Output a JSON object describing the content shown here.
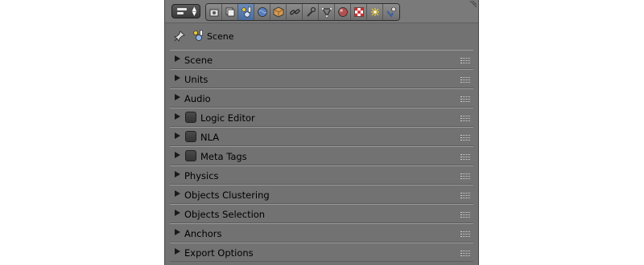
{
  "header": {
    "editor_type_icon": "properties-editor-icon",
    "tabs": [
      {
        "icon": "render-icon",
        "active": false
      },
      {
        "icon": "render-layers-icon",
        "active": false
      },
      {
        "icon": "scene-icon",
        "active": true
      },
      {
        "icon": "world-icon",
        "active": false
      },
      {
        "icon": "object-icon",
        "active": false
      },
      {
        "icon": "constraints-icon",
        "active": false
      },
      {
        "icon": "modifier-wrench-icon",
        "active": false
      },
      {
        "icon": "mesh-data-icon",
        "active": false
      },
      {
        "icon": "material-icon",
        "active": false
      },
      {
        "icon": "texture-icon",
        "active": false
      },
      {
        "icon": "particles-icon",
        "active": false
      },
      {
        "icon": "physics-icon",
        "active": false
      }
    ]
  },
  "context": {
    "label": "Scene"
  },
  "panels": [
    {
      "label": "Scene",
      "checkbox": false
    },
    {
      "label": "Units",
      "checkbox": false
    },
    {
      "label": "Audio",
      "checkbox": false
    },
    {
      "label": "Logic Editor",
      "checkbox": true
    },
    {
      "label": "NLA",
      "checkbox": true
    },
    {
      "label": "Meta Tags",
      "checkbox": true
    },
    {
      "label": "Physics",
      "checkbox": false
    },
    {
      "label": "Objects Clustering",
      "checkbox": false
    },
    {
      "label": "Objects Selection",
      "checkbox": false
    },
    {
      "label": "Anchors",
      "checkbox": false
    },
    {
      "label": "Export Options",
      "checkbox": false
    }
  ],
  "colors": {
    "panel_bg": "#727272",
    "active_tab": "#5a7cad"
  }
}
